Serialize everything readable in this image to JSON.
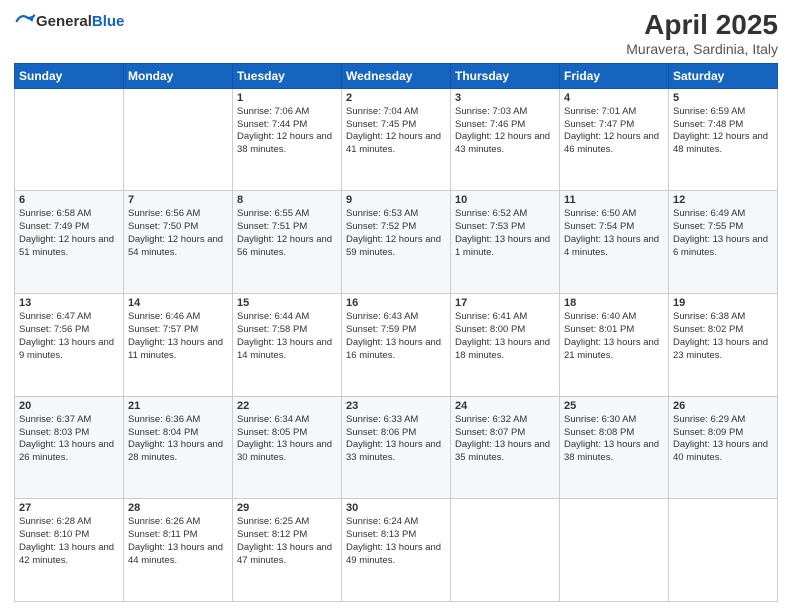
{
  "header": {
    "logo_general": "General",
    "logo_blue": "Blue",
    "main_title": "April 2025",
    "subtitle": "Muravera, Sardinia, Italy"
  },
  "weekdays": [
    "Sunday",
    "Monday",
    "Tuesday",
    "Wednesday",
    "Thursday",
    "Friday",
    "Saturday"
  ],
  "weeks": [
    [
      {
        "day": "",
        "info": ""
      },
      {
        "day": "",
        "info": ""
      },
      {
        "day": "1",
        "info": "Sunrise: 7:06 AM\nSunset: 7:44 PM\nDaylight: 12 hours and 38 minutes."
      },
      {
        "day": "2",
        "info": "Sunrise: 7:04 AM\nSunset: 7:45 PM\nDaylight: 12 hours and 41 minutes."
      },
      {
        "day": "3",
        "info": "Sunrise: 7:03 AM\nSunset: 7:46 PM\nDaylight: 12 hours and 43 minutes."
      },
      {
        "day": "4",
        "info": "Sunrise: 7:01 AM\nSunset: 7:47 PM\nDaylight: 12 hours and 46 minutes."
      },
      {
        "day": "5",
        "info": "Sunrise: 6:59 AM\nSunset: 7:48 PM\nDaylight: 12 hours and 48 minutes."
      }
    ],
    [
      {
        "day": "6",
        "info": "Sunrise: 6:58 AM\nSunset: 7:49 PM\nDaylight: 12 hours and 51 minutes."
      },
      {
        "day": "7",
        "info": "Sunrise: 6:56 AM\nSunset: 7:50 PM\nDaylight: 12 hours and 54 minutes."
      },
      {
        "day": "8",
        "info": "Sunrise: 6:55 AM\nSunset: 7:51 PM\nDaylight: 12 hours and 56 minutes."
      },
      {
        "day": "9",
        "info": "Sunrise: 6:53 AM\nSunset: 7:52 PM\nDaylight: 12 hours and 59 minutes."
      },
      {
        "day": "10",
        "info": "Sunrise: 6:52 AM\nSunset: 7:53 PM\nDaylight: 13 hours and 1 minute."
      },
      {
        "day": "11",
        "info": "Sunrise: 6:50 AM\nSunset: 7:54 PM\nDaylight: 13 hours and 4 minutes."
      },
      {
        "day": "12",
        "info": "Sunrise: 6:49 AM\nSunset: 7:55 PM\nDaylight: 13 hours and 6 minutes."
      }
    ],
    [
      {
        "day": "13",
        "info": "Sunrise: 6:47 AM\nSunset: 7:56 PM\nDaylight: 13 hours and 9 minutes."
      },
      {
        "day": "14",
        "info": "Sunrise: 6:46 AM\nSunset: 7:57 PM\nDaylight: 13 hours and 11 minutes."
      },
      {
        "day": "15",
        "info": "Sunrise: 6:44 AM\nSunset: 7:58 PM\nDaylight: 13 hours and 14 minutes."
      },
      {
        "day": "16",
        "info": "Sunrise: 6:43 AM\nSunset: 7:59 PM\nDaylight: 13 hours and 16 minutes."
      },
      {
        "day": "17",
        "info": "Sunrise: 6:41 AM\nSunset: 8:00 PM\nDaylight: 13 hours and 18 minutes."
      },
      {
        "day": "18",
        "info": "Sunrise: 6:40 AM\nSunset: 8:01 PM\nDaylight: 13 hours and 21 minutes."
      },
      {
        "day": "19",
        "info": "Sunrise: 6:38 AM\nSunset: 8:02 PM\nDaylight: 13 hours and 23 minutes."
      }
    ],
    [
      {
        "day": "20",
        "info": "Sunrise: 6:37 AM\nSunset: 8:03 PM\nDaylight: 13 hours and 26 minutes."
      },
      {
        "day": "21",
        "info": "Sunrise: 6:36 AM\nSunset: 8:04 PM\nDaylight: 13 hours and 28 minutes."
      },
      {
        "day": "22",
        "info": "Sunrise: 6:34 AM\nSunset: 8:05 PM\nDaylight: 13 hours and 30 minutes."
      },
      {
        "day": "23",
        "info": "Sunrise: 6:33 AM\nSunset: 8:06 PM\nDaylight: 13 hours and 33 minutes."
      },
      {
        "day": "24",
        "info": "Sunrise: 6:32 AM\nSunset: 8:07 PM\nDaylight: 13 hours and 35 minutes."
      },
      {
        "day": "25",
        "info": "Sunrise: 6:30 AM\nSunset: 8:08 PM\nDaylight: 13 hours and 38 minutes."
      },
      {
        "day": "26",
        "info": "Sunrise: 6:29 AM\nSunset: 8:09 PM\nDaylight: 13 hours and 40 minutes."
      }
    ],
    [
      {
        "day": "27",
        "info": "Sunrise: 6:28 AM\nSunset: 8:10 PM\nDaylight: 13 hours and 42 minutes."
      },
      {
        "day": "28",
        "info": "Sunrise: 6:26 AM\nSunset: 8:11 PM\nDaylight: 13 hours and 44 minutes."
      },
      {
        "day": "29",
        "info": "Sunrise: 6:25 AM\nSunset: 8:12 PM\nDaylight: 13 hours and 47 minutes."
      },
      {
        "day": "30",
        "info": "Sunrise: 6:24 AM\nSunset: 8:13 PM\nDaylight: 13 hours and 49 minutes."
      },
      {
        "day": "",
        "info": ""
      },
      {
        "day": "",
        "info": ""
      },
      {
        "day": "",
        "info": ""
      }
    ]
  ]
}
